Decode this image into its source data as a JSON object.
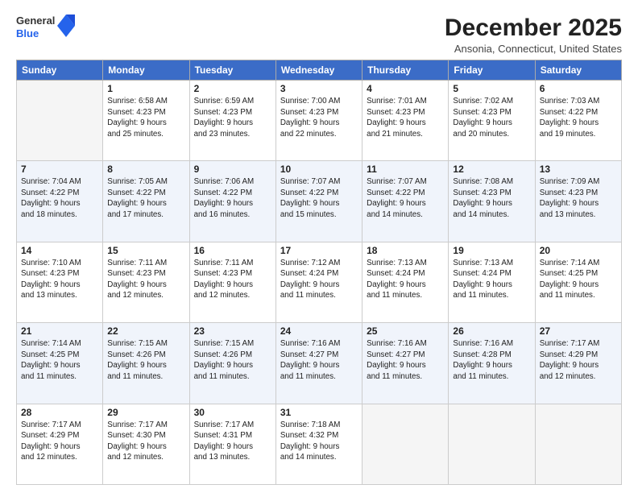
{
  "logo": {
    "line1": "General",
    "line2": "Blue"
  },
  "title": "December 2025",
  "subtitle": "Ansonia, Connecticut, United States",
  "weekdays": [
    "Sunday",
    "Monday",
    "Tuesday",
    "Wednesday",
    "Thursday",
    "Friday",
    "Saturday"
  ],
  "weeks": [
    [
      {
        "day": "",
        "info": ""
      },
      {
        "day": "1",
        "info": "Sunrise: 6:58 AM\nSunset: 4:23 PM\nDaylight: 9 hours\nand 25 minutes."
      },
      {
        "day": "2",
        "info": "Sunrise: 6:59 AM\nSunset: 4:23 PM\nDaylight: 9 hours\nand 23 minutes."
      },
      {
        "day": "3",
        "info": "Sunrise: 7:00 AM\nSunset: 4:23 PM\nDaylight: 9 hours\nand 22 minutes."
      },
      {
        "day": "4",
        "info": "Sunrise: 7:01 AM\nSunset: 4:23 PM\nDaylight: 9 hours\nand 21 minutes."
      },
      {
        "day": "5",
        "info": "Sunrise: 7:02 AM\nSunset: 4:23 PM\nDaylight: 9 hours\nand 20 minutes."
      },
      {
        "day": "6",
        "info": "Sunrise: 7:03 AM\nSunset: 4:22 PM\nDaylight: 9 hours\nand 19 minutes."
      }
    ],
    [
      {
        "day": "7",
        "info": "Sunrise: 7:04 AM\nSunset: 4:22 PM\nDaylight: 9 hours\nand 18 minutes."
      },
      {
        "day": "8",
        "info": "Sunrise: 7:05 AM\nSunset: 4:22 PM\nDaylight: 9 hours\nand 17 minutes."
      },
      {
        "day": "9",
        "info": "Sunrise: 7:06 AM\nSunset: 4:22 PM\nDaylight: 9 hours\nand 16 minutes."
      },
      {
        "day": "10",
        "info": "Sunrise: 7:07 AM\nSunset: 4:22 PM\nDaylight: 9 hours\nand 15 minutes."
      },
      {
        "day": "11",
        "info": "Sunrise: 7:07 AM\nSunset: 4:22 PM\nDaylight: 9 hours\nand 14 minutes."
      },
      {
        "day": "12",
        "info": "Sunrise: 7:08 AM\nSunset: 4:23 PM\nDaylight: 9 hours\nand 14 minutes."
      },
      {
        "day": "13",
        "info": "Sunrise: 7:09 AM\nSunset: 4:23 PM\nDaylight: 9 hours\nand 13 minutes."
      }
    ],
    [
      {
        "day": "14",
        "info": "Sunrise: 7:10 AM\nSunset: 4:23 PM\nDaylight: 9 hours\nand 13 minutes."
      },
      {
        "day": "15",
        "info": "Sunrise: 7:11 AM\nSunset: 4:23 PM\nDaylight: 9 hours\nand 12 minutes."
      },
      {
        "day": "16",
        "info": "Sunrise: 7:11 AM\nSunset: 4:23 PM\nDaylight: 9 hours\nand 12 minutes."
      },
      {
        "day": "17",
        "info": "Sunrise: 7:12 AM\nSunset: 4:24 PM\nDaylight: 9 hours\nand 11 minutes."
      },
      {
        "day": "18",
        "info": "Sunrise: 7:13 AM\nSunset: 4:24 PM\nDaylight: 9 hours\nand 11 minutes."
      },
      {
        "day": "19",
        "info": "Sunrise: 7:13 AM\nSunset: 4:24 PM\nDaylight: 9 hours\nand 11 minutes."
      },
      {
        "day": "20",
        "info": "Sunrise: 7:14 AM\nSunset: 4:25 PM\nDaylight: 9 hours\nand 11 minutes."
      }
    ],
    [
      {
        "day": "21",
        "info": "Sunrise: 7:14 AM\nSunset: 4:25 PM\nDaylight: 9 hours\nand 11 minutes."
      },
      {
        "day": "22",
        "info": "Sunrise: 7:15 AM\nSunset: 4:26 PM\nDaylight: 9 hours\nand 11 minutes."
      },
      {
        "day": "23",
        "info": "Sunrise: 7:15 AM\nSunset: 4:26 PM\nDaylight: 9 hours\nand 11 minutes."
      },
      {
        "day": "24",
        "info": "Sunrise: 7:16 AM\nSunset: 4:27 PM\nDaylight: 9 hours\nand 11 minutes."
      },
      {
        "day": "25",
        "info": "Sunrise: 7:16 AM\nSunset: 4:27 PM\nDaylight: 9 hours\nand 11 minutes."
      },
      {
        "day": "26",
        "info": "Sunrise: 7:16 AM\nSunset: 4:28 PM\nDaylight: 9 hours\nand 11 minutes."
      },
      {
        "day": "27",
        "info": "Sunrise: 7:17 AM\nSunset: 4:29 PM\nDaylight: 9 hours\nand 12 minutes."
      }
    ],
    [
      {
        "day": "28",
        "info": "Sunrise: 7:17 AM\nSunset: 4:29 PM\nDaylight: 9 hours\nand 12 minutes."
      },
      {
        "day": "29",
        "info": "Sunrise: 7:17 AM\nSunset: 4:30 PM\nDaylight: 9 hours\nand 12 minutes."
      },
      {
        "day": "30",
        "info": "Sunrise: 7:17 AM\nSunset: 4:31 PM\nDaylight: 9 hours\nand 13 minutes."
      },
      {
        "day": "31",
        "info": "Sunrise: 7:18 AM\nSunset: 4:32 PM\nDaylight: 9 hours\nand 14 minutes."
      },
      {
        "day": "",
        "info": ""
      },
      {
        "day": "",
        "info": ""
      },
      {
        "day": "",
        "info": ""
      }
    ]
  ]
}
